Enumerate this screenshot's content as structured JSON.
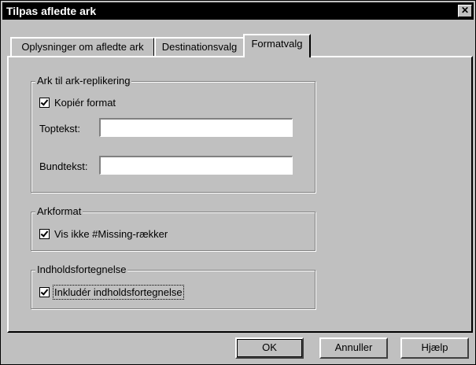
{
  "window": {
    "title": "Tilpas afledte ark",
    "close_glyph": "✕"
  },
  "tabs": [
    {
      "label": "Oplysninger om afledte ark",
      "active": false
    },
    {
      "label": "Destinationsvalg",
      "active": false
    },
    {
      "label": "Formatvalg",
      "active": true
    }
  ],
  "groups": {
    "replication": {
      "legend": "Ark til ark-replikering",
      "copy_format": {
        "label": "Kopiér format",
        "checked": true
      },
      "header_label": "Toptekst:",
      "header_value": "",
      "footer_label": "Bundtekst:",
      "footer_value": ""
    },
    "sheet_format": {
      "legend": "Arkformat",
      "hide_missing": {
        "label": "Vis ikke #Missing-rækker",
        "checked": true
      }
    },
    "toc": {
      "legend": "Indholdsfortegnelse",
      "include_toc": {
        "label": "Inkludér indholdsfortegnelse",
        "checked": true
      }
    }
  },
  "buttons": {
    "ok": "OK",
    "cancel": "Annuller",
    "help": "Hjælp"
  }
}
